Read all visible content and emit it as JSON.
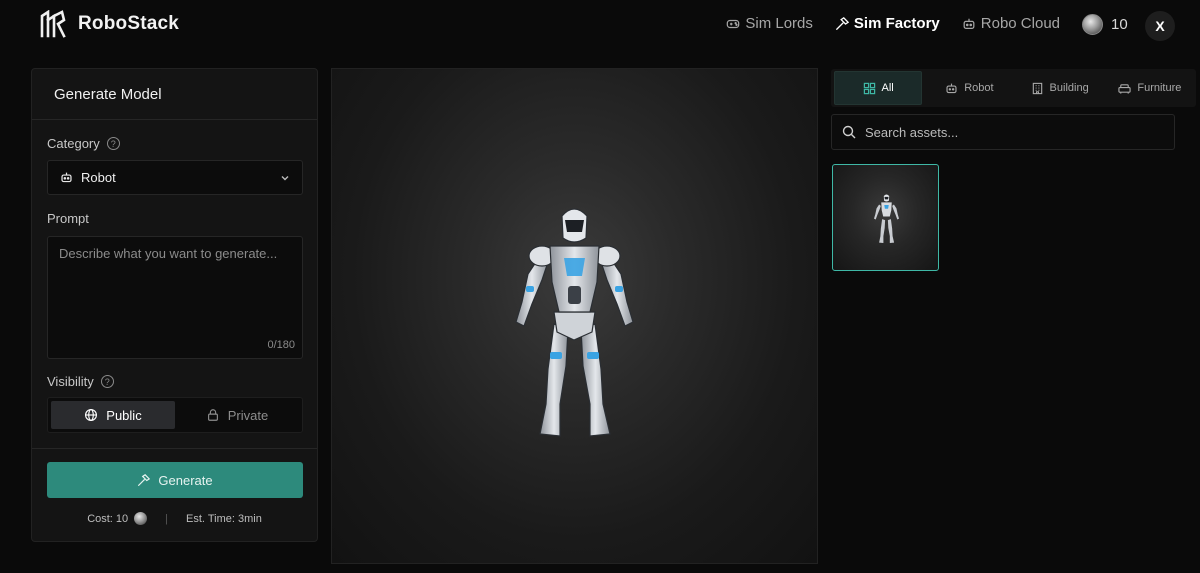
{
  "app": {
    "name": "RoboStack"
  },
  "nav": {
    "items": [
      {
        "label": "Sim Lords",
        "icon": "gamepad-icon",
        "active": false
      },
      {
        "label": "Sim Factory",
        "icon": "hammer-icon",
        "active": true
      },
      {
        "label": "Robo Cloud",
        "icon": "robot-icon",
        "active": false
      }
    ],
    "credits": "10",
    "close_label": "X"
  },
  "generate": {
    "title": "Generate Model",
    "category_label": "Category",
    "category_value": "Robot",
    "prompt_label": "Prompt",
    "prompt_placeholder": "Describe what you want to generate...",
    "prompt_counter": "0/180",
    "visibility_label": "Visibility",
    "visibility_options": [
      "Public",
      "Private"
    ],
    "visibility_selected": "Public",
    "generate_label": "Generate",
    "cost_label": "Cost: 10",
    "time_label": "Est. Time: 3min",
    "separator": "|"
  },
  "assets": {
    "filters": [
      {
        "label": "All",
        "icon": "grid-icon"
      },
      {
        "label": "Robot",
        "icon": "robot-icon"
      },
      {
        "label": "Building",
        "icon": "building-icon"
      },
      {
        "label": "Furniture",
        "icon": "sofa-icon"
      }
    ],
    "active_filter": "All",
    "search_placeholder": "Search assets..."
  },
  "colors": {
    "accent": "#2d8a7c",
    "selection_border": "#3fb8a6",
    "background": "#0a0a0a"
  }
}
